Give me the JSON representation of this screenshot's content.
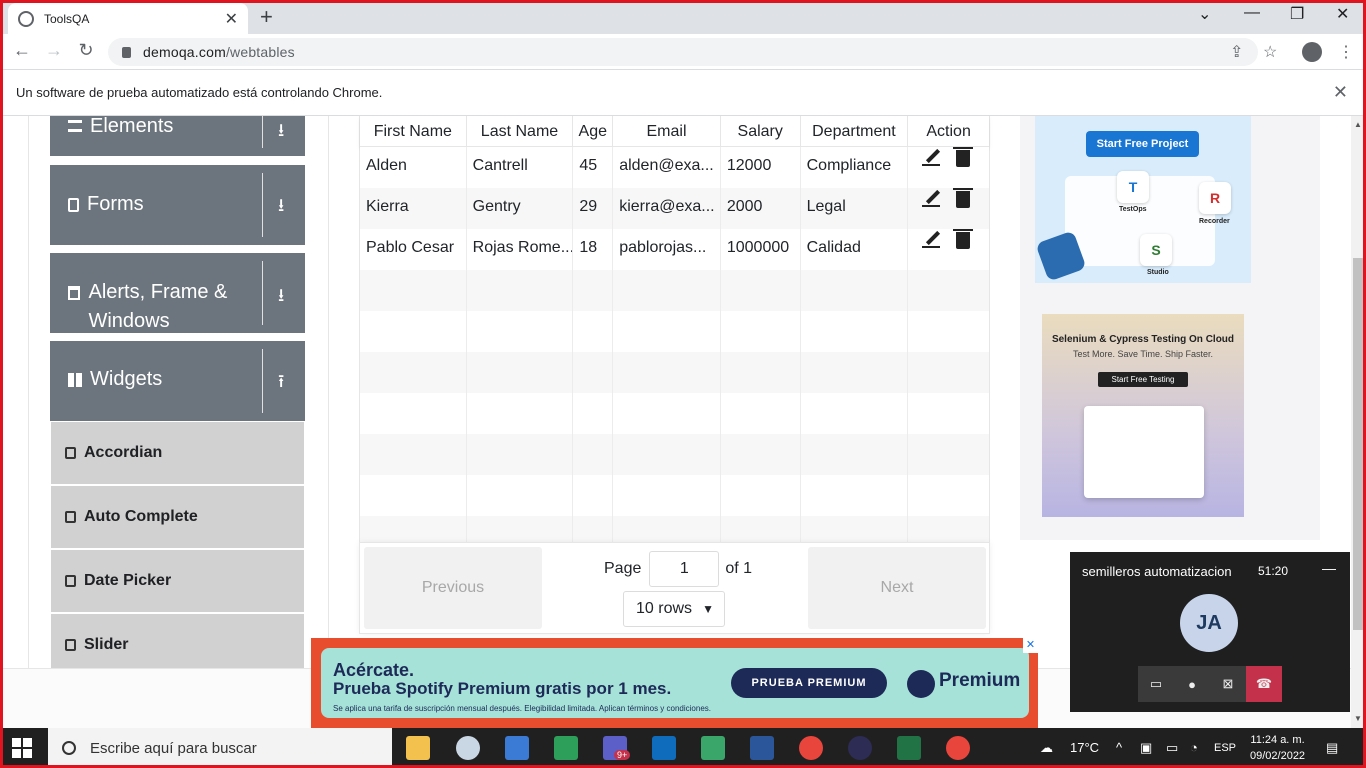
{
  "browser": {
    "tab_title": "ToolsQA",
    "url_host": "demoqa.com",
    "url_path": "/webtables",
    "infobar_text": "Un software de prueba automatizado está controlando Chrome."
  },
  "sidebar": {
    "groups": [
      {
        "label": "Elements"
      },
      {
        "label": "Forms"
      },
      {
        "label": "Alerts, Frame & Windows"
      },
      {
        "label": "Widgets"
      }
    ],
    "widget_items": [
      {
        "label": "Accordian"
      },
      {
        "label": "Auto Complete"
      },
      {
        "label": "Date Picker"
      },
      {
        "label": "Slider"
      }
    ]
  },
  "table": {
    "headers": [
      "First Name",
      "Last Name",
      "Age",
      "Email",
      "Salary",
      "Department",
      "Action"
    ],
    "rows": [
      [
        "Alden",
        "Cantrell",
        "45",
        "alden@exa...",
        "12000",
        "Compliance"
      ],
      [
        "Kierra",
        "Gentry",
        "29",
        "kierra@exa...",
        "2000",
        "Legal"
      ],
      [
        "Pablo Cesar",
        "Rojas Rome...",
        "18",
        "pablorojas...",
        "1000000",
        "Calidad"
      ]
    ],
    "empty_rows": 7
  },
  "pagination": {
    "previous_label": "Previous",
    "next_label": "Next",
    "page_label": "Page",
    "page_value": "1",
    "of_label": "of 1",
    "rows_select": "10 rows"
  },
  "ads": {
    "ad1_button": "Start Free Project",
    "ad1_labels": [
      "TestOps",
      "Recorder",
      "Studio"
    ],
    "ad2_title": "Selenium & Cypress Testing On Cloud",
    "ad2_subtitle": "Test More. Save Time. Ship Faster.",
    "ad2_button": "Start Free Testing"
  },
  "meeting": {
    "title": "semilleros automatizacion",
    "time": "51:20",
    "initials": "JA"
  },
  "spotify": {
    "line1": "Acércate.",
    "line2": "Prueba Spotify Premium gratis por 1 mes.",
    "line3": "Se aplica una tarifa de suscripción mensual después. Elegibilidad limitada. Aplican términos y condiciones.",
    "button": "PRUEBA PREMIUM",
    "brand": "Premium"
  },
  "taskbar": {
    "search_placeholder": "Escribe aquí para buscar",
    "teams_badge": "9+",
    "weather": "17°C",
    "language": "ESP",
    "time": "11:24 a. m.",
    "date": "09/02/2022"
  },
  "colors": {
    "sidebar_group": "#6c757d",
    "sidebar_item": "#d1d1d1",
    "frame": "#e0141e",
    "spotify_bg": "#a6e2d8"
  }
}
